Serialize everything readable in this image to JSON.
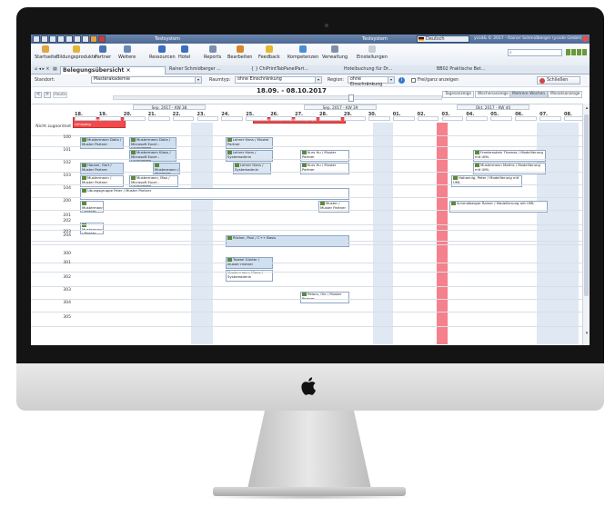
{
  "window": {
    "system_left": "Testsystem",
    "system_right": "Testsystem",
    "language": "Deutsch",
    "user_info": "ycsd& © 2017 - Rainer Schmidberger (ycsde GmbH)"
  },
  "ribbon": [
    {
      "label": "Startseite",
      "color": "#e0a640"
    },
    {
      "label": "Bildungsprodukte",
      "color": "#e3b63b"
    },
    {
      "label": "Partner",
      "color": "#4a72b0"
    },
    {
      "label": "Weitere",
      "color": "#6b88b8"
    },
    {
      "label": "Ressourcen",
      "color": "#3a6fc0"
    },
    {
      "label": "Hotel",
      "color": "#3a6fc0"
    },
    {
      "label": "Reports",
      "color": "#7a8fb0"
    },
    {
      "label": "Bearbeiten",
      "color": "#d8882e"
    },
    {
      "label": "Feedback",
      "color": "#e5b82f"
    },
    {
      "label": "Kompetenzen",
      "color": "#4a8fd0"
    },
    {
      "label": "Verwaltung",
      "color": "#8090a8"
    },
    {
      "label": "Einstellungen",
      "color": "#c9cfd8"
    }
  ],
  "tabs": [
    {
      "label": "Belegungsübersicht",
      "active": true
    },
    {
      "label": "Rainer Schmidberger ...",
      "active": false
    },
    {
      "label": "{ } ChiPrintTabPanelPart...",
      "active": false
    },
    {
      "label": "Hotelbuchung für Dr...",
      "active": false
    },
    {
      "label": "BB02 Praktische Bet...",
      "active": false
    }
  ],
  "filters": {
    "standort_label": "Standort:",
    "standort_value": "Masterakademie",
    "raumtyp_label": "Raumtyp:",
    "raumtyp_value": "ohne Einschränkung",
    "region_label": "Region:",
    "region_value": "ohne Einschränkung",
    "frei_label": "Frei/ganz anzeigen",
    "close_label": "Schließen"
  },
  "nav": {
    "prev": "<",
    "next": ">",
    "today": "Heute",
    "range": "18.09. - 08.10.2017",
    "views": [
      {
        "label": "Tagesanzeige",
        "active": false
      },
      {
        "label": "Wochenanzeige",
        "active": false
      },
      {
        "label": "Mehrere Wochen",
        "active": true
      },
      {
        "label": "Monatsanzeige",
        "active": false
      }
    ]
  },
  "calendar": {
    "weeks": [
      {
        "label": "Sep. 2017 - KW 38"
      },
      {
        "label": "Sep. 2017 - KW 39"
      },
      {
        "label": "Okt. 2017 - KW 40"
      }
    ],
    "days": [
      "18.",
      "19.",
      "20.",
      "21.",
      "22.",
      "23.",
      "24.",
      "25.",
      "26.",
      "27.",
      "28.",
      "29.",
      "30.",
      "01.",
      "02.",
      "03.",
      "04.",
      "05.",
      "06.",
      "07.",
      "08."
    ],
    "rows": [
      "Nicht zugeordnet",
      "100",
      "101",
      "102",
      "103",
      "104",
      "200",
      "201",
      "202",
      "203",
      "204",
      "300",
      "301",
      "302",
      "303",
      "304",
      "305"
    ],
    "bookings": [
      {
        "text": "Praktikum Dos / Beispiel Lehrgang",
        "color": "#f04a4a"
      },
      {
        "text": "Praktikum Dos / Beispiel Lehrgang",
        "color": "#f04a4a"
      },
      {
        "text": "Mustermann Dalia / Muster Partner",
        "color": "#cfe0f2"
      },
      {
        "text": "Mustermann Dalia / Microsoft Excel - Grundlagen",
        "color": "#cfe0f2"
      },
      {
        "text": "Lehrer Hans / Muster Partner",
        "color": "#dbe6f3"
      },
      {
        "text": "Mustermann Klaus / Microsoft Excel - Grundlagen",
        "color": "#cfe0f2"
      },
      {
        "text": "Lehrer Hans / Systemadmin",
        "color": "#dbe6f3"
      },
      {
        "text": "Kurs Hu / Muster Partner",
        "color": "#fff"
      },
      {
        "text": "Frankenstein Thomas / Modellierung mit UML",
        "color": "#fff"
      },
      {
        "text": "Hauser, Gert / Muster Partner",
        "color": "#cfe0f2"
      },
      {
        "text": "Mustermann / Microsoft Excel",
        "color": "#cfe0f2"
      },
      {
        "text": "Lehrer Hans / Systemadmin",
        "color": "#dbe6f3"
      },
      {
        "text": "Kurs Hu / Muster Partner",
        "color": "#fff"
      },
      {
        "text": "Mustermann Mathis / Modellierung mit UML",
        "color": "#fff"
      },
      {
        "text": "Mustermann / Muster Partner",
        "color": "#fff"
      },
      {
        "text": "Mustermann, Max / Microsoft Excel - Grundlagen",
        "color": "#fff"
      },
      {
        "text": "Hohannig, Peter / Modellierung mit UML",
        "color": "#fff"
      },
      {
        "text": "Ubungsgruppe Feier / Muster Partner",
        "color": "#fff"
      },
      {
        "text": "Mustermann / Muster Partner",
        "color": "#fff"
      },
      {
        "text": "Muster / Muster Partner",
        "color": "#fff"
      },
      {
        "text": "Schmidberger Rainer / Modellierung mit UML",
        "color": "#fff"
      },
      {
        "text": "Mustermann / Muster Partner",
        "color": "#fff"
      },
      {
        "text": "Rücker, Paul / C++ Basis",
        "color": "#cfe0f2"
      },
      {
        "text": "Trostel Günter / Muster Partner",
        "color": "#cfe0f2"
      },
      {
        "text": "Mustermann, Klaus / Systemadmin",
        "color": "#fff"
      },
      {
        "text": "Peters, Ole / Muster Partner",
        "color": "#fff"
      }
    ]
  }
}
